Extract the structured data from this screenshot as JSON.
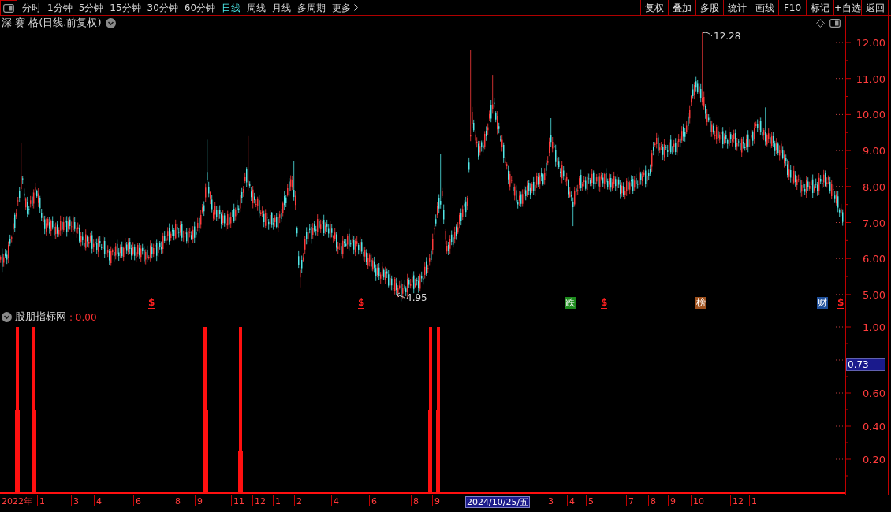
{
  "toolbar": {
    "periods": [
      {
        "label": "分时",
        "selected": false
      },
      {
        "label": "1分钟",
        "selected": false
      },
      {
        "label": "5分钟",
        "selected": false
      },
      {
        "label": "15分钟",
        "selected": false
      },
      {
        "label": "30分钟",
        "selected": false
      },
      {
        "label": "60分钟",
        "selected": false
      },
      {
        "label": "日线",
        "selected": true
      },
      {
        "label": "周线",
        "selected": false
      },
      {
        "label": "月线",
        "selected": false
      },
      {
        "label": "多周期",
        "selected": false
      },
      {
        "label": "更多",
        "selected": false
      }
    ],
    "buttons": [
      "复权",
      "叠加",
      "多股",
      "统计",
      "画线",
      "F10",
      "标记",
      "+自选",
      "返回"
    ]
  },
  "price_pane": {
    "title": "深 赛 格(日线.前复权)",
    "axis_labels": [
      "12.00",
      "11.00",
      "10.00",
      "9.00",
      "8.00",
      "7.00",
      "6.00",
      "5.00"
    ],
    "high_label": "12.28",
    "low_label": "4.95",
    "markers": [
      {
        "kind": "symbol",
        "text": "$"
      },
      {
        "kind": "symbol",
        "text": "$"
      },
      {
        "kind": "badge",
        "text": "跌",
        "color": "#1e8c1e"
      },
      {
        "kind": "symbol",
        "text": "$"
      },
      {
        "kind": "badge",
        "text": "榜",
        "color": "#a0521e"
      },
      {
        "kind": "badge",
        "text": "财",
        "color": "#1e4f9a"
      },
      {
        "kind": "symbol",
        "text": "$"
      }
    ]
  },
  "indicator_pane": {
    "title": "股朋指标网",
    "value": ": 0.00",
    "axis_labels": [
      "1.00",
      "0.60",
      "0.40",
      "0.20"
    ],
    "cursor_value": "0.73"
  },
  "date_axis": [
    {
      "text": "2022年",
      "highlighted": false
    },
    {
      "text": "1",
      "highlighted": false
    },
    {
      "text": "3",
      "highlighted": false
    },
    {
      "text": "4",
      "highlighted": false
    },
    {
      "text": "6",
      "highlighted": false
    },
    {
      "text": "8",
      "highlighted": false
    },
    {
      "text": "9",
      "highlighted": false
    },
    {
      "text": "11",
      "highlighted": false
    },
    {
      "text": "12",
      "highlighted": false
    },
    {
      "text": "1",
      "highlighted": false
    },
    {
      "text": "2",
      "highlighted": false
    },
    {
      "text": "4",
      "highlighted": false
    },
    {
      "text": "6",
      "highlighted": false
    },
    {
      "text": "8",
      "highlighted": false
    },
    {
      "text": "9",
      "highlighted": false
    },
    {
      "text": "2024/10/25/五",
      "highlighted": true
    },
    {
      "text": "3",
      "highlighted": false
    },
    {
      "text": "4",
      "highlighted": false
    },
    {
      "text": "5",
      "highlighted": false
    },
    {
      "text": "7",
      "highlighted": false
    },
    {
      "text": "8",
      "highlighted": false
    },
    {
      "text": "9",
      "highlighted": false
    },
    {
      "text": "10",
      "highlighted": false
    },
    {
      "text": "12",
      "highlighted": false
    },
    {
      "text": "1",
      "highlighted": false
    }
  ]
}
